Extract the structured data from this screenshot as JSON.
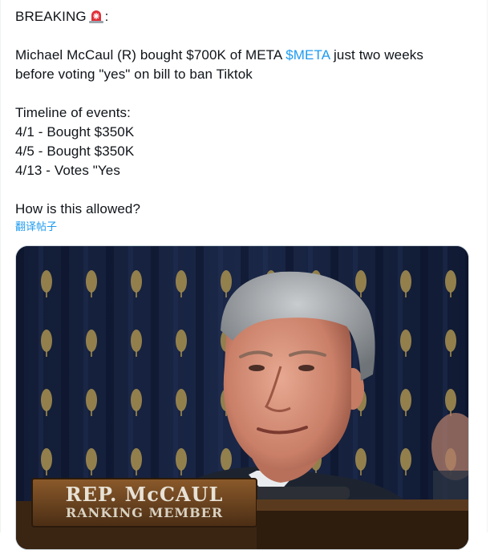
{
  "tweet": {
    "line1_text": "BREAKING",
    "line1_suffix": ":",
    "emoji_icon": "rotating-light-icon",
    "line2_pre": "Michael McCaul (R) bought $700K of META ",
    "cashtag": "$META",
    "line2_post": " just two weeks",
    "line3": "before voting \"yes\" on bill to ban Tiktok",
    "line5": "Timeline of events:",
    "line6": "4/1 - Bought $350K",
    "line7": "4/5 - Bought $350K",
    "line8": "4/13 - Votes \"Yes",
    "line10": "How is this allowed?",
    "translate_label": "翻译帖子"
  },
  "media": {
    "nameplate_line1": "REP. McCAUL",
    "nameplate_line2": "RANKING MEMBER"
  },
  "colors": {
    "accent": "#1d9bf0",
    "text": "#0f1419",
    "curtain": "#0f1a33"
  }
}
